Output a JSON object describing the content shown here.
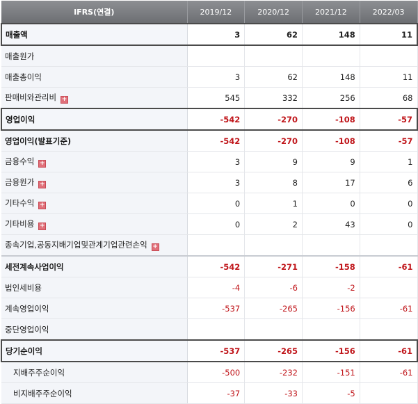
{
  "header": {
    "label": "IFRS(연결)",
    "periods": [
      "2019/12",
      "2020/12",
      "2021/12",
      "2022/03"
    ]
  },
  "expand_icon_glyph": "+",
  "rows": [
    {
      "label": "매출액",
      "values": [
        "3",
        "62",
        "148",
        "11"
      ],
      "style": "boxed"
    },
    {
      "label": "매출원가",
      "values": [
        "",
        "",
        "",
        ""
      ]
    },
    {
      "label": "매출총이익",
      "values": [
        "3",
        "62",
        "148",
        "11"
      ]
    },
    {
      "label": "판매비와관리비",
      "values": [
        "545",
        "332",
        "256",
        "68"
      ],
      "expand": true
    },
    {
      "label": "영업이익",
      "values": [
        "-542",
        "-270",
        "-108",
        "-57"
      ],
      "style": "boxed"
    },
    {
      "label": "영업이익(발표기준)",
      "values": [
        "-542",
        "-270",
        "-108",
        "-57"
      ],
      "style": "bold"
    },
    {
      "label": "금융수익",
      "values": [
        "3",
        "9",
        "9",
        "1"
      ],
      "expand": true
    },
    {
      "label": "금융원가",
      "values": [
        "3",
        "8",
        "17",
        "6"
      ],
      "expand": true
    },
    {
      "label": "기타수익",
      "values": [
        "0",
        "1",
        "0",
        "0"
      ],
      "expand": true
    },
    {
      "label": "기타비용",
      "values": [
        "0",
        "2",
        "43",
        "0"
      ],
      "expand": true
    },
    {
      "label": "종속기업,공동지배기업및관계기업관련손익",
      "values": [
        "",
        "",
        "",
        ""
      ],
      "expand": true
    },
    {
      "label": "세전계속사업이익",
      "values": [
        "-542",
        "-271",
        "-158",
        "-61"
      ],
      "style": "bold"
    },
    {
      "label": "법인세비용",
      "values": [
        "-4",
        "-6",
        "-2",
        ""
      ]
    },
    {
      "label": "계속영업이익",
      "values": [
        "-537",
        "-265",
        "-156",
        "-61"
      ]
    },
    {
      "label": "중단영업이익",
      "values": [
        "",
        "",
        "",
        ""
      ]
    },
    {
      "label": "당기순이익",
      "values": [
        "-537",
        "-265",
        "-156",
        "-61"
      ],
      "style": "boxed"
    },
    {
      "label": "지배주주순이익",
      "values": [
        "-500",
        "-232",
        "-151",
        "-61"
      ],
      "indent": true
    },
    {
      "label": "비지배주주순이익",
      "values": [
        "-37",
        "-33",
        "-5",
        ""
      ],
      "indent": true
    }
  ]
}
